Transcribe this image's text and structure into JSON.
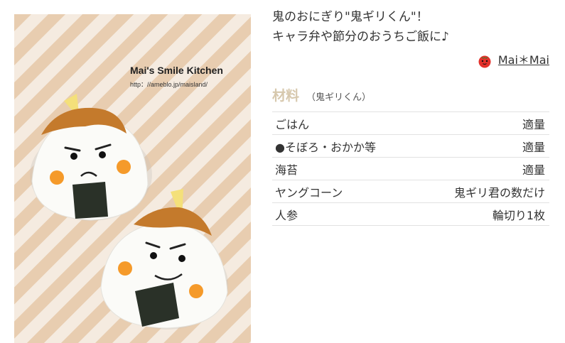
{
  "photo": {
    "title": "Mai's Smile Kitchen",
    "url": "http：//ameblo.jp/maisland/"
  },
  "description": {
    "line1": "鬼のおにぎり\"鬼ギリくん\"！",
    "line2": "キャラ弁や節分のおうちご飯に♪"
  },
  "author": {
    "name": "Mai＊Mai",
    "icon": "tomato-icon"
  },
  "ingredients": {
    "title": "材料",
    "subtitle": "（鬼ギリくん）",
    "items": [
      {
        "name": "ごはん",
        "amount": "適量"
      },
      {
        "name": "●そぼろ・おかか等",
        "amount": "適量"
      },
      {
        "name": "海苔",
        "amount": "適量"
      },
      {
        "name": "ヤングコーン",
        "amount": "鬼ギリ君の数だけ"
      },
      {
        "name": "人参",
        "amount": "輪切り1枚"
      }
    ]
  },
  "colors": {
    "accent": "#d7c8ad",
    "stripe_light": "#f4e9dd",
    "stripe_dark": "#e6c9a8"
  }
}
